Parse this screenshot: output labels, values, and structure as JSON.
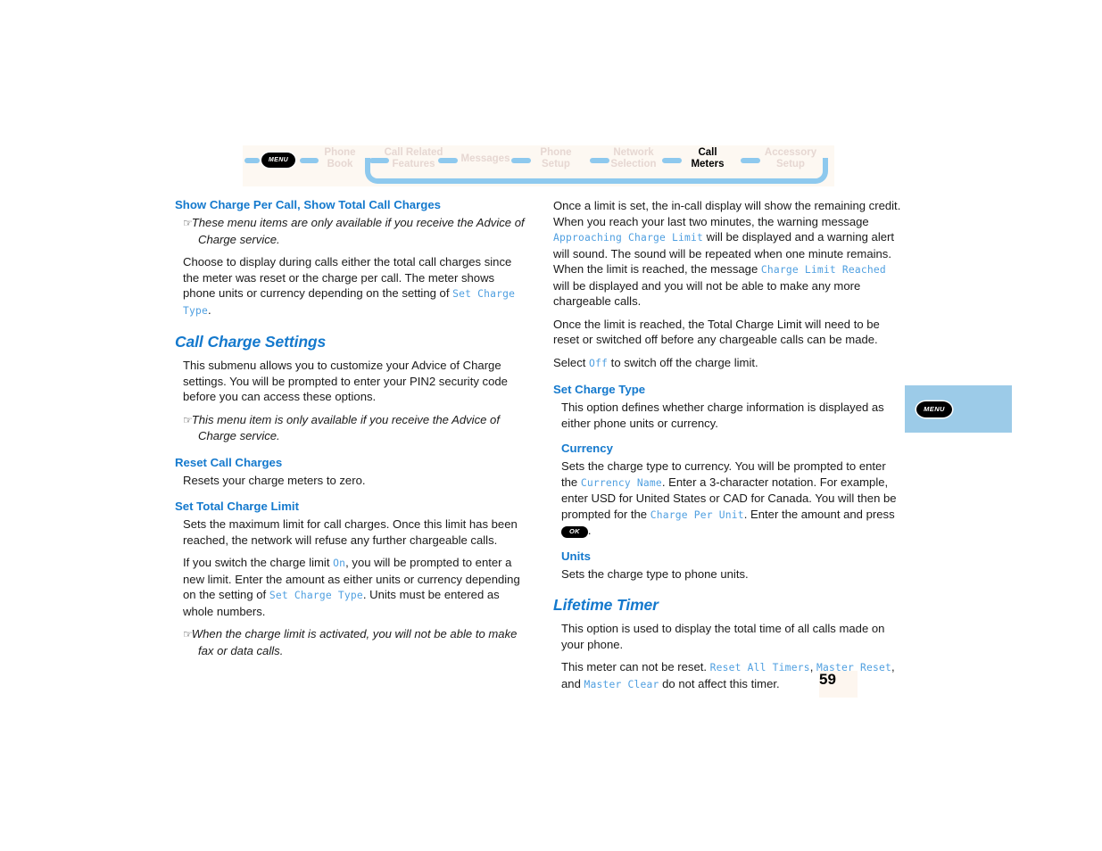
{
  "nav": {
    "menu_chip_label": "MENU",
    "items": [
      {
        "lines": [
          "Phone",
          "Book"
        ],
        "active": false
      },
      {
        "lines": [
          "Call Related",
          "Features"
        ],
        "active": false
      },
      {
        "lines": [
          "Messages"
        ],
        "active": false
      },
      {
        "lines": [
          "Phone",
          "Setup"
        ],
        "active": false
      },
      {
        "lines": [
          "Network",
          "Selection"
        ],
        "active": false
      },
      {
        "lines": [
          "Call",
          "Meters"
        ],
        "active": true
      },
      {
        "lines": [
          "Accessory",
          "Setup"
        ],
        "active": false
      }
    ]
  },
  "colors": {
    "heading_blue": "#1479cd",
    "device_text_blue": "#4f9fe0",
    "nav_bar_blue": "#8ec9ee",
    "nav_strip_bg": "#fdf8f2",
    "side_tab_bg": "#9ccbe8",
    "page_number_bg": "#fdf6ef"
  },
  "left_column": {
    "heading_show_charge": "Show Charge Per Call, Show Total Call Charges",
    "note_1_a": "These menu items are only available if you receive the Advice",
    "note_1_b": "of Charge service.",
    "para_choose_1": "Choose to display during calls either the total call charges since the meter was reset or the charge per call. The meter shows phone units or currency depending on the setting of ",
    "mono_set_charge_type": "Set Charge Type",
    "para_choose_end": ".",
    "heading_call_charge_settings": "Call Charge Settings",
    "para_submenu": "This submenu allows you to customize your Advice of Charge settings. You will be prompted to enter your PIN2 security code before you can access these options.",
    "note_2_a": "This menu item is only available if you receive the Advice of",
    "note_2_b": "Charge service.",
    "heading_reset_call_charges": "Reset Call Charges",
    "para_resets": "Resets your charge meters to zero.",
    "heading_set_total_charge_limit": "Set Total Charge Limit",
    "para_sets_max": "Sets the maximum limit for call charges. Once this limit has been reached, the network will refuse any further chargeable calls.",
    "para_switch_pre": "If you switch the charge limit ",
    "mono_on": "On",
    "para_switch_mid": ", you will be prompted to enter a new limit. Enter the amount as either units or currency depending on the setting of ",
    "mono_set_charge_type_2": "Set Charge Type",
    "para_switch_end": ". Units must be entered as whole numbers.",
    "note_3_a": "When the charge limit is activated, you will not be able to",
    "note_3_b": "make fax or data calls."
  },
  "right_column": {
    "para_once_pre": "Once a limit is set, the in-call display will show the remaining credit. When you reach your last two minutes, the warning message ",
    "mono_approaching": "Approaching Charge Limit",
    "para_once_mid": " will be displayed and a warning alert will sound. The sound will be repeated when one minute remains. When the limit is reached, the message ",
    "mono_limit_reached": "Charge Limit Reached",
    "para_once_end": " will be displayed and you will not be able to make any more chargeable calls.",
    "para_once_reached": "Once the limit is reached, the Total Charge Limit will need to be reset or switched off before any chargeable calls can be made.",
    "para_select_pre": "Select ",
    "mono_off": "Off",
    "para_select_end": " to switch off the charge limit.",
    "heading_set_charge_type": "Set Charge Type",
    "para_option_defines": "This option defines whether charge information is displayed as either phone units or currency.",
    "heading_currency": "Currency",
    "para_currency_pre": "Sets the charge type to currency. You will be prompted to enter the ",
    "mono_currency_name": "Currency Name",
    "para_currency_mid": ". Enter a 3-character notation. For example, enter USD for United States or CAD for Canada. You will then be prompted for the ",
    "mono_charge_per_unit": "Charge Per Unit",
    "para_currency_end": ". Enter the amount and press ",
    "ok_chip_label": "OK",
    "para_currency_period": ".",
    "heading_units": "Units",
    "para_units": "Sets the charge type to phone units.",
    "heading_lifetime_timer": "Lifetime Timer",
    "para_lifetime": "This option is used to display the total time of all calls made on your phone.",
    "para_meter_pre": "This meter can not be reset. ",
    "mono_reset_all_timers": "Reset All Timers",
    "para_meter_comma": ", ",
    "mono_master_reset": "Master Reset",
    "para_meter_and": ", and ",
    "mono_master_clear": "Master Clear",
    "para_meter_end": " do not affect this timer."
  },
  "side_tab": {
    "chip_label": "MENU"
  },
  "footer": {
    "page_number": "59"
  },
  "icons": {
    "hand_pointer": "☞"
  }
}
